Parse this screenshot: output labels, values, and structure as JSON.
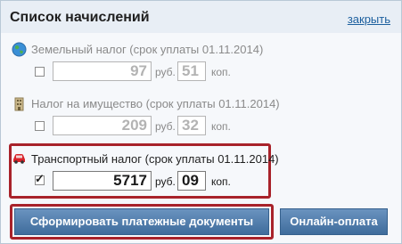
{
  "panel": {
    "title": "Список начислений",
    "close_label": "закрыть"
  },
  "taxes": [
    {
      "label": "Земельный налог (срок уплаты 01.11.2014)",
      "icon": "globe-icon",
      "checked": false,
      "amount_rub": "97",
      "amount_kop": "51",
      "rub_unit": "руб.",
      "kop_unit": "коп."
    },
    {
      "label": "Налог на имущество (срок уплаты 01.11.2014)",
      "icon": "building-icon",
      "checked": false,
      "amount_rub": "209",
      "amount_kop": "32",
      "rub_unit": "руб.",
      "kop_unit": "коп."
    },
    {
      "label": "Транспортный налог (срок уплаты 01.11.2014)",
      "icon": "car-icon",
      "checked": true,
      "amount_rub": "5717",
      "amount_kop": "09",
      "rub_unit": "руб.",
      "kop_unit": "коп."
    }
  ],
  "buttons": {
    "generate": "Сформировать платежные документы",
    "online_pay": "Онлайн-оплата"
  },
  "colors": {
    "highlight": "#a8222a",
    "link": "#1c5f9e",
    "button": "#4a76a4"
  }
}
